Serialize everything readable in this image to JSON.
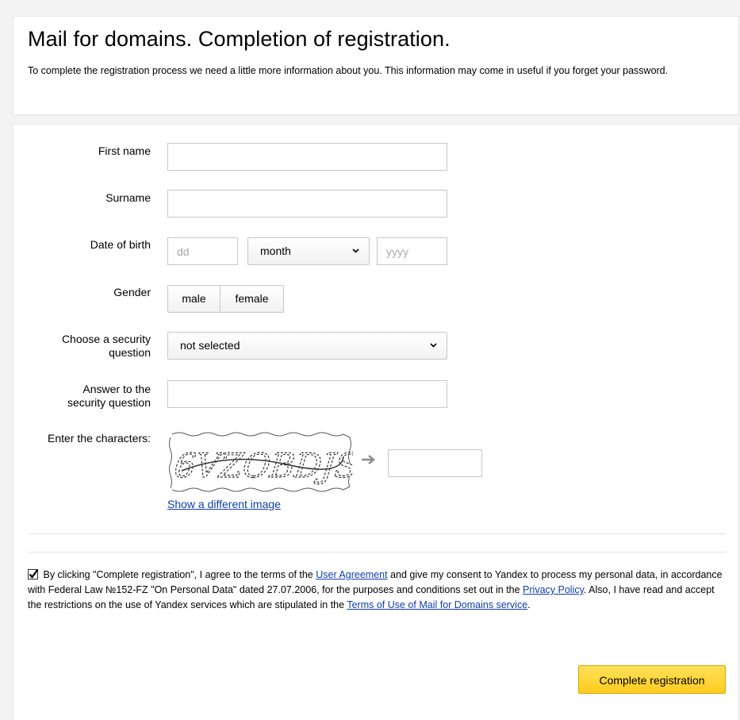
{
  "header": {
    "title": "Mail for domains. Completion of registration.",
    "intro": "To complete the registration process we need a little more information about you. This information may come in useful if you forget your password."
  },
  "form": {
    "first_name": {
      "label": "First name",
      "value": ""
    },
    "surname": {
      "label": "Surname",
      "value": ""
    },
    "dob": {
      "label": "Date of birth",
      "day_placeholder": "dd",
      "month_selected": "month",
      "year_placeholder": "yyyy"
    },
    "gender": {
      "label": "Gender",
      "options": [
        "male",
        "female"
      ]
    },
    "security_question": {
      "label_line1": "Choose a security",
      "label_line2": "question",
      "selected": "not selected"
    },
    "answer": {
      "label_line1": "Answer to the",
      "label_line2": "security question",
      "value": ""
    },
    "captcha": {
      "label": "Enter the characters:",
      "image_text": "6VZOBDJS",
      "value": "",
      "show_different": "Show a different image"
    }
  },
  "consent": {
    "checked": true,
    "text_1": "By clicking \"Complete registration\", I agree to the terms of the ",
    "link_user_agreement": "User Agreement",
    "text_2": " and give my consent to Yandex to  process my personal data, in accordance with Federal Law №152-FZ \"On Personal Data\" dated 27.07.2006, for the purposes and conditions set out in the ",
    "link_privacy_policy": "Privacy Policy",
    "text_3": ". Also, I have read and accept the restrictions on the use of Yandex services which are stipulated in the ",
    "link_terms": "Terms of Use of Mail for Domains service",
    "text_4": "."
  },
  "submit_label": "Complete registration",
  "colors": {
    "accent_button": "#ffcc33",
    "link": "#0f3fa8",
    "background": "#f3f3f3"
  }
}
